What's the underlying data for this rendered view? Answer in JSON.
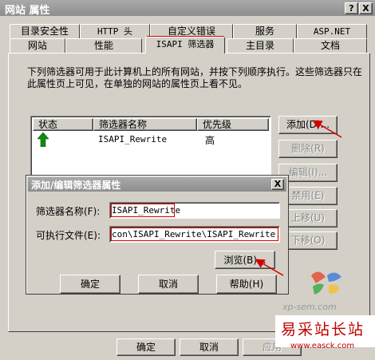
{
  "window": {
    "title": "网站 属性",
    "help_btn": "?",
    "close_btn": "X"
  },
  "tabs": {
    "row1": [
      "目录安全性",
      "HTTP 头",
      "自定义错误",
      "服务",
      "ASP.NET"
    ],
    "row2": [
      "网站",
      "性能",
      "ISAPI 筛选器",
      "主目录",
      "文档"
    ],
    "active": "ISAPI 筛选器"
  },
  "description": "下列筛选器可用于此计算机上的所有网站，并按下列顺序执行。这些筛选器只在此属性页上可见，在单独的网站的属性页上看不见。",
  "filter_list": {
    "columns": [
      "状态",
      "筛选器名称",
      "优先级"
    ],
    "rows": [
      {
        "status_icon": "green-up-arrow-icon",
        "name": "ISAPI_Rewrite",
        "priority": "高"
      }
    ]
  },
  "side_buttons": {
    "add": "添加(D)...",
    "remove": "删除(R)",
    "edit": "编辑(I)...",
    "disable": "禁用(E)",
    "move_up": "上移(U)",
    "move_down": "下移(O)"
  },
  "bottom_buttons": {
    "ok": "确定",
    "cancel": "取消",
    "apply": "应用"
  },
  "dialog": {
    "title": "添加/编辑筛选器属性",
    "close_btn": "X",
    "name_label": "筛选器名称(F):",
    "name_value": "ISAPI_Rewrite",
    "exe_label": "可执行文件(E):",
    "exe_value": "con\\ISAPI_Rewrite\\ISAPI_Rewrite.dll",
    "browse": "浏览(B)...",
    "ok": "确定",
    "cancel": "取消",
    "help": "帮助(H)"
  },
  "watermark": {
    "site_name": "易采站长站",
    "site_url": "www.easck.com",
    "logo_text": "xp-sem.com"
  },
  "colors": {
    "face": "#d4d0c8",
    "titlebar": "#8e8e8e",
    "highlight_red": "#d40000",
    "arrow_green": "#118a11"
  }
}
